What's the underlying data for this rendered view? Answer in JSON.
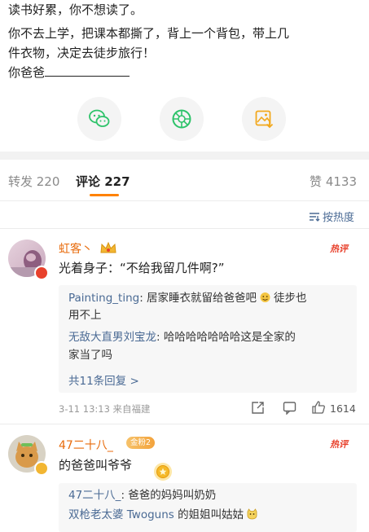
{
  "post": {
    "line1": "读书好累，你不想读了。",
    "line2": "你不去上学，把课本都撕了，背上一个背包，带上几",
    "line3": "件衣物，决定去徒步旅行！",
    "line4": "你爸爸"
  },
  "share_buttons": [
    "wechat-icon",
    "moments-icon",
    "save-image-icon"
  ],
  "tabs": [
    {
      "label": "转发 220"
    },
    {
      "label": "评论 227"
    },
    {
      "label": "赞 4133"
    }
  ],
  "sort": {
    "label": "按热度",
    "icon": "sort-icon"
  },
  "comments": [
    {
      "username": "虹客丶",
      "badge": "crown-icon",
      "hot_tag": "热评",
      "text": "光着身子：“不给我留几件啊?”",
      "replies": [
        {
          "name": "Painting_ting",
          "text_line1": "居家睡衣就留给爸爸吧",
          "emoji": "face-emoji-icon",
          "text_line1_end": "徒步也",
          "text_line2": "用不上"
        },
        {
          "name": "无敌大直男刘宝龙",
          "text_line1": "哈哈哈哈哈哈哈这是全家的",
          "text_line2": "家当了吗"
        }
      ],
      "more_replies": "共11条回复 >",
      "meta": "3-11 13:13 来自福建",
      "likes": "1614"
    },
    {
      "username": "47二十八_",
      "fan_badge": "金粉2",
      "hot_tag": "热评",
      "text": "的爸爸叫爷爷",
      "replies": [
        {
          "name": "47二十八_",
          "text_line1": "爸爸的妈妈叫奶奶"
        },
        {
          "name": "双枪老太婆 Twoguns",
          "text_line1": "的姐姐叫姑姑"
        }
      ]
    }
  ],
  "colors": {
    "accent": "#ff8200",
    "username": "#e86b0c",
    "link": "#4a6a94",
    "hot": "#e8412c"
  }
}
